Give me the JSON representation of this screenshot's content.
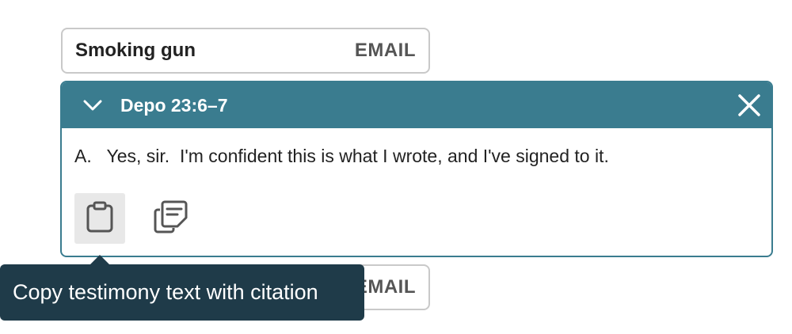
{
  "chips": {
    "top": {
      "title": "Smoking gun",
      "action": "EMAIL"
    },
    "bottom": {
      "title": "",
      "action": "EMAIL"
    }
  },
  "panel": {
    "header": {
      "title": "Depo 23:6–7",
      "collapse_icon": "chevron-down-icon",
      "close_icon": "close-icon"
    },
    "testimony": "A.   Yes, sir.  I'm confident this is what I wrote, and I've signed to it.",
    "actions": [
      {
        "name": "copy-with-citation",
        "icon": "clipboard-icon",
        "active": true
      },
      {
        "name": "copy-to-note",
        "icon": "copy-note-icon",
        "active": false
      }
    ]
  },
  "tooltip": {
    "text": "Copy testimony text with citation"
  },
  "colors": {
    "header_bg": "#3a7c8f",
    "tooltip_bg": "#1f3b49",
    "chip_border": "#c9c9c9"
  }
}
